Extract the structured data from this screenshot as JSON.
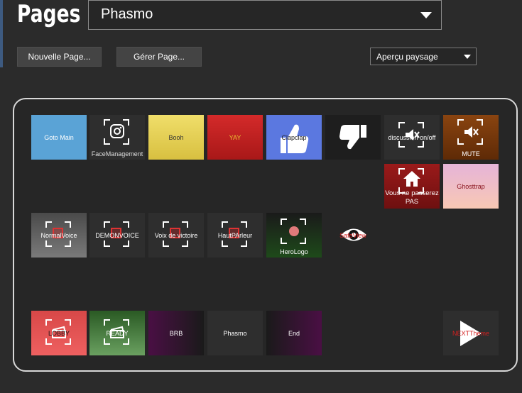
{
  "header": {
    "title": "Pages",
    "page_selector_value": "Phasmo",
    "new_page_label": "Nouvelle Page...",
    "manage_page_label": "Gérer Page...",
    "layout_selector_value": "Aperçu paysage"
  },
  "keys": {
    "goto_main": "Goto Main",
    "face_management": "FaceManagement",
    "booh": "Booh",
    "yay": "YAY",
    "clapclap": "Clapclap",
    "dislike": "",
    "discussion": "discussion on/off",
    "mute": "MUTE",
    "vous_ne_passerez": "Vous ne passerez PAS",
    "ghosttrap": "Ghosttrap",
    "normal_voice": "NormalVoice",
    "demon_voice": "DEMONVOICE",
    "voix_victoire": "Voix de victoire",
    "haut_parleur": "HautPArleur",
    "hero_logo": "HeroLogo",
    "safe_view": "SafeView",
    "lobby": "LOBBY",
    "ready": "READY",
    "brb": "BRB",
    "phasmo": "Phasmo",
    "end": "End",
    "next_theme": "NEXTTheme"
  },
  "colors": {
    "goto_main": "#5aa3d6",
    "booh": "#e8d55a",
    "yay": "#c42424",
    "clapclap": "#5b78e0",
    "mute": "#7a3c0c",
    "vous_ne_passerez": "#8b1515",
    "ghosttrap": "#f5b5c5",
    "hero_logo": "#1e4a1a",
    "lobby": "#e05252",
    "ready": "#5c9a52",
    "brb": "#4a0f44",
    "end": "#4a0f44"
  },
  "icons": [
    "chevron-down-icon",
    "instagram-icon",
    "thumbs-up-icon",
    "thumbs-down-icon",
    "speaker-mute-icon",
    "house-icon",
    "record-dot-icon",
    "eye-icon",
    "clapperboard-icon",
    "play-icon"
  ]
}
